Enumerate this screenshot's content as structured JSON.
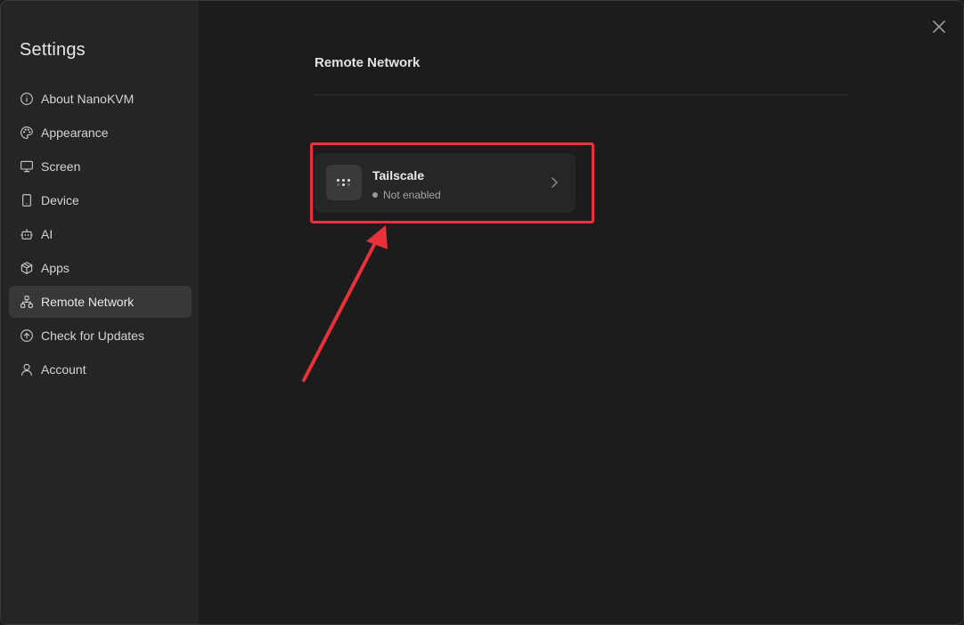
{
  "sidebar": {
    "title": "Settings",
    "items": [
      {
        "label": "About NanoKVM",
        "icon": "info-icon"
      },
      {
        "label": "Appearance",
        "icon": "palette-icon"
      },
      {
        "label": "Screen",
        "icon": "monitor-icon"
      },
      {
        "label": "Device",
        "icon": "smartphone-icon"
      },
      {
        "label": "AI",
        "icon": "bot-icon"
      },
      {
        "label": "Apps",
        "icon": "package-icon"
      },
      {
        "label": "Remote Network",
        "icon": "network-icon",
        "active": true
      },
      {
        "label": "Check for Updates",
        "icon": "arrow-up-circle-icon"
      },
      {
        "label": "Account",
        "icon": "user-icon"
      }
    ]
  },
  "main": {
    "title": "Remote Network",
    "card": {
      "title": "Tailscale",
      "status": "Not enabled",
      "icon": "tailscale-icon"
    }
  },
  "colors": {
    "highlight": "#e8313a",
    "sidebar_bg": "#252525",
    "main_bg": "#1c1c1c",
    "active_item_bg": "#373737"
  }
}
